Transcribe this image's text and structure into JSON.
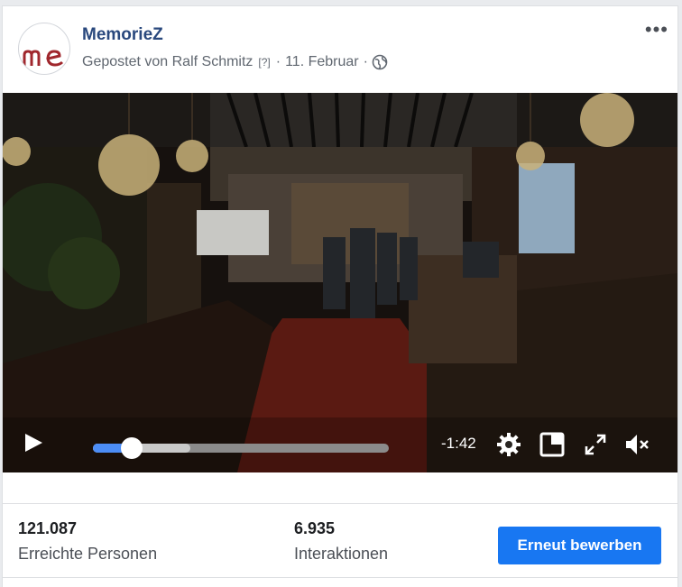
{
  "post": {
    "page_name": "MemorieZ",
    "posted_by": "Gepostet von Ralf Schmitz",
    "help_marker": "[?]",
    "separator": "·",
    "date": "11. Februar",
    "avatar_text": "m"
  },
  "video": {
    "time_remaining": "-1:42",
    "progress_fraction": 0.13,
    "buffered_fraction": 0.33,
    "muted": true
  },
  "stats": {
    "reach_value": "121.087",
    "reach_label": "Erreichte Personen",
    "engagement_value": "6.935",
    "engagement_label": "Interaktionen",
    "boost_label": "Erneut bewerben"
  },
  "colors": {
    "page_name": "#29487d",
    "button": "#1877f2",
    "progress": "#4c8df6",
    "avatar_logo": "#a0272d"
  },
  "icons": {
    "more": "more-options-icon",
    "privacy": "globe-icon",
    "play": "play-icon",
    "settings": "gear-icon",
    "pip": "picture-in-picture-icon",
    "fullscreen": "fullscreen-icon",
    "volume": "volume-muted-icon"
  }
}
